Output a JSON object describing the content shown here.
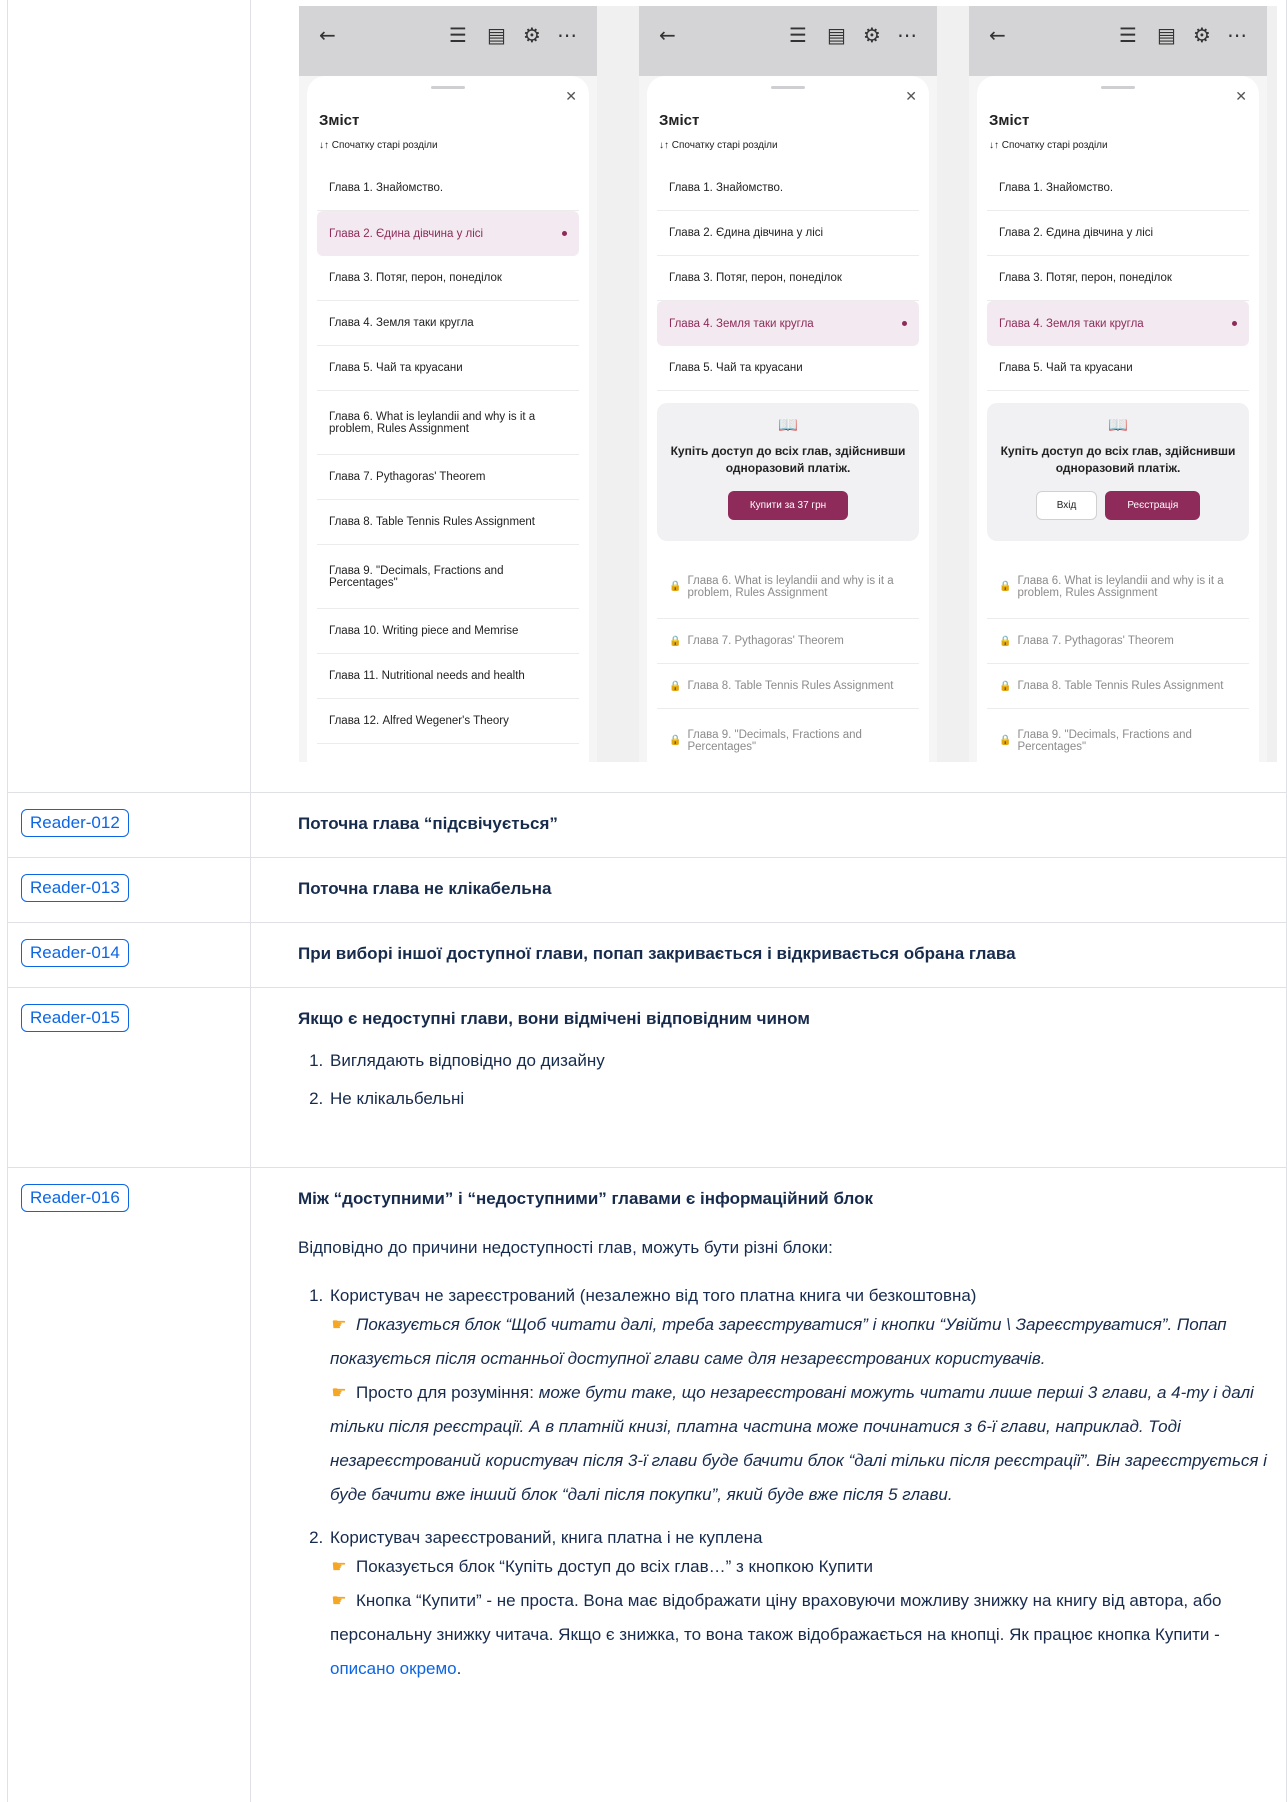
{
  "screens": [
    {
      "title": "Зміст",
      "sort": "↓↑ Спочатку старі розділи",
      "chapters": [
        {
          "label": "Глава 1. Знайомство."
        },
        {
          "label": "Глава 2. Єдина дівчина у лісі",
          "active": true
        },
        {
          "label": "Глава 3. Потяг,  перон,  понеділок"
        },
        {
          "label": "Глава 4. Земля таки кругла"
        },
        {
          "label": "Глава 5. Чай та  круасани"
        },
        {
          "label": "Глава 6. What is leylandii and why is it a problem, Rules Assignment",
          "tall": true
        },
        {
          "label": "Глава 7. Pythagoras' Theorem"
        },
        {
          "label": "Глава 8. Table Tennis Rules Assignment"
        },
        {
          "label": "Глава 9. \"Decimals, Fractions and Percentages\"",
          "tall": true
        },
        {
          "label": "Глава 10. Writing piece and Memrise"
        },
        {
          "label": "Глава 11. Nutritional needs and health"
        },
        {
          "label": "Глава 12. Alfred Wegener's Theory"
        }
      ]
    },
    {
      "title": "Зміст",
      "sort": "↓↑ Спочатку старі розділи",
      "chapters": [
        {
          "label": "Глава 1. Знайомство."
        },
        {
          "label": "Глава 2. Єдина дівчина у лісі"
        },
        {
          "label": "Глава 3. Потяг,  перон,  понеділок"
        },
        {
          "label": "Глава 4. Земля таки кругла",
          "active": true
        },
        {
          "label": "Глава 5. Чай та  круасани"
        }
      ],
      "paybox": {
        "text": "Купіть доступ до всіх глав, здійснивши одноразовий платіж.",
        "buy_label": "Купити за 37 грн"
      },
      "locked": [
        {
          "label": "Глава 6. What is leylandii and why is it a problem, Rules Assignment",
          "tall": true
        },
        {
          "label": "Глава 7. Pythagoras' Theorem"
        },
        {
          "label": "Глава 8. Table Tennis Rules Assignment"
        },
        {
          "label": "Глава 9. \"Decimals, Fractions and Percentages\"",
          "tall": true
        }
      ]
    },
    {
      "title": "Зміст",
      "sort": "↓↑ Спочатку старі розділи",
      "chapters": [
        {
          "label": "Глава 1. Знайомство."
        },
        {
          "label": "Глава 2. Єдина дівчина у лісі"
        },
        {
          "label": "Глава 3. Потяг,  перон,  понеділок"
        },
        {
          "label": "Глава 4. Земля таки кругла",
          "active": true
        },
        {
          "label": "Глава 5. Чай та  круасани"
        }
      ],
      "paybox": {
        "text": "Купіть доступ до всіх глав, здійснивши одноразовий платіж.",
        "login_label": "Вхід",
        "register_label": "Реєстрація"
      },
      "locked": [
        {
          "label": "Глава 6. What is leylandii and why is it a problem, Rules Assignment",
          "tall": true
        },
        {
          "label": "Глава 7. Pythagoras' Theorem"
        },
        {
          "label": "Глава 8. Table Tennis Rules Assignment"
        },
        {
          "label": "Глава 9. \"Decimals, Fractions and Percentages\"",
          "tall": true
        }
      ]
    }
  ],
  "icons": {
    "back": "arrow-left-icon",
    "toc": "list-icon",
    "book": "book-settings-icon",
    "settings": "gear-icon",
    "more": "more-icon",
    "close": "close-icon",
    "lock": "lock-icon"
  },
  "colors": {
    "accent": "#8e2b5a",
    "link": "#0c66e4"
  },
  "rows": [
    {
      "id": "Reader-012",
      "title": "Поточна глава “підсвічується”"
    },
    {
      "id": "Reader-013",
      "title": "Поточна глава не клікабельна"
    },
    {
      "id": "Reader-014",
      "title": "При виборі іншої доступної глави, попап закривається і відкривається обрана глава"
    },
    {
      "id": "Reader-015",
      "title": "Якщо є недоступні глави, вони відмічені відповідним чином",
      "items": [
        "Виглядають відповідно до дизайну",
        "Не клікальбельні"
      ]
    },
    {
      "id": "Reader-016",
      "title": "Між “доступними” і “недоступними” главами є інформаційний блок",
      "intro": "Відповідно до причини недоступності глав, можуть бути різні блоки:",
      "item1": "Користувач не зареєстрований (незалежно від того платна книга чи безкоштовна)",
      "item1_note1": "Показується блок “Щоб читати далі, треба зареєструватися” і кнопки “Увійти \\ Зареєструватися”. Попап показується після останньої доступної глави саме для незареєстрованих користувачів.",
      "item1_note2_lead": "Просто для розуміння:",
      "item1_note2": "може бути таке, що незареєстровані можуть читати лише перші 3 глави, а 4-ту і далі тільки після реєстрації. А в платній книзі, платна частина може починатися з 6-ї глави, наприклад. Тоді незареєстрований користувач після 3-ї глави буде бачити блок “далі тільки після реєстрації”. Він зареєструється і буде бачити вже інший блок “далі після покупки”, який буде вже після 5 глави.",
      "item2": "Користувач зареєстрований, книга платна і не куплена",
      "item2_note1": "Показується блок “Купіть доступ до всіх глав…” з кнопкою Купити",
      "item2_note2": "Кнопка “Купити” - не проста. Вона має відображати ціну враховуючи можливу знижку на книгу від автора, або персональну знижку читача. Якщо є знижка, то вона також відображається на кнопці. Як працює кнопка Купити -",
      "item2_link": "описано окремо",
      "item2_end": "."
    }
  ]
}
